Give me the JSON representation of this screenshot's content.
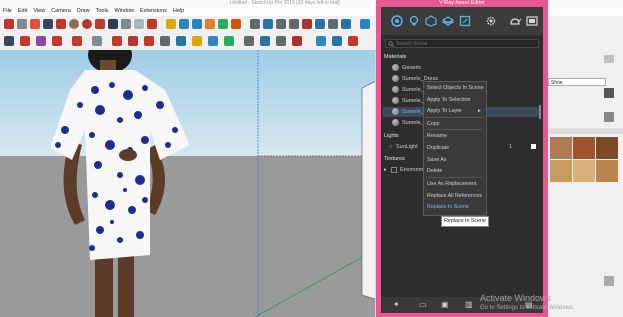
{
  "titlebar": {
    "text": "Untitled - SketchUp Pro 2019 (30 days left in trial)"
  },
  "menus": [
    "File",
    "Edit",
    "View",
    "Camera",
    "Draw",
    "Tools",
    "Window",
    "Extensions",
    "Help"
  ],
  "vray": {
    "title": "V-Ray Asset Editor",
    "search_placeholder": "Search Scene",
    "materials_header": "Materials",
    "materials": [
      "Generic",
      "Sumele_Dress",
      "Sumele_Skin",
      "Sumele_Hair",
      "Sumele_Shoe",
      "Sumele_Eyes"
    ],
    "lights_header": "Lights",
    "light_item": "SunLight",
    "light_count": "1",
    "textures_header": "Textures",
    "texture_item": "Environment"
  },
  "context_menu": {
    "items": [
      "Select Objects In Scene",
      "Apply To Selection",
      "Apply To Layer",
      "Copy",
      "Rename",
      "Duplicate",
      "Save As",
      "Delete",
      "Use As Replacement",
      "Replace All References",
      "Replace In Scene"
    ],
    "tooltip": "Replace In Scene"
  },
  "dock": {
    "field_value": "Shoe"
  },
  "watermark": {
    "line1": "Activate Windows",
    "line2": "Go to Settings to activate Windows."
  },
  "colors": {
    "vray_border": "#e8578f",
    "panel_bg": "#2d2d2d",
    "sky": "#9fcde6"
  }
}
